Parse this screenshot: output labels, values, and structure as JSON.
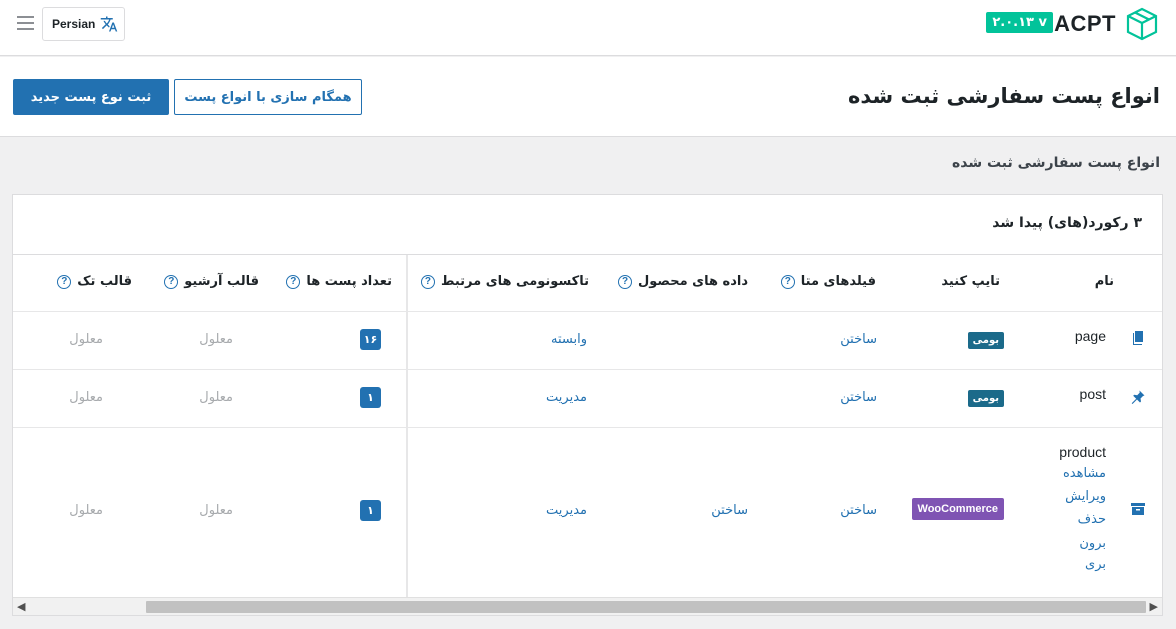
{
  "topbar": {
    "logo_text": "ACPT",
    "version": "۲.۰.۱۳ v",
    "language": "Persian"
  },
  "header": {
    "title": "انواع پست سفارشی ثبت شده",
    "primary_button": "ثبت نوع پست جدید",
    "secondary_button": "همگام سازی با انواع پست"
  },
  "subheading": "انواع پست سفارشی ثبت شده",
  "table": {
    "records_found": "۳ رکورد(های) پیدا شد",
    "columns": {
      "name": "نام",
      "type": "تایپ کنید",
      "meta_fields": "فیلدهای متا",
      "product_data": "داده های محصول",
      "taxonomies": "تاکسونومی های مرتبط",
      "post_count": "تعداد پست ها",
      "archive_template": "قالب آرشیو",
      "single_template": "قالب تک"
    },
    "rows": [
      {
        "icon": "page-icon",
        "name": "page",
        "type": "بومی",
        "meta_fields": "ساختن",
        "product_data": "",
        "taxonomies": "وابسته",
        "post_count": "۱۶",
        "archive_template": "معلول",
        "single_template": "معلول"
      },
      {
        "icon": "pin-icon",
        "name": "post",
        "type": "بومی",
        "meta_fields": "ساختن",
        "product_data": "",
        "taxonomies": "مدیریت",
        "post_count": "۱",
        "archive_template": "معلول",
        "single_template": "معلول"
      },
      {
        "icon": "archive-box-icon",
        "name": "product",
        "actions": [
          "مشاهده",
          "ویرایش",
          "حذف",
          "برون",
          "بری"
        ],
        "type": "WooCommerce",
        "meta_fields": "ساختن",
        "product_data": "ساختن",
        "taxonomies": "مدیریت",
        "post_count": "۱",
        "archive_template": "معلول",
        "single_template": "معلول"
      }
    ]
  },
  "colors": {
    "accent": "#2271b1",
    "version_badge": "#02c39a",
    "native_badge": "#1b6a8a",
    "woo_badge": "#7f54b3"
  }
}
